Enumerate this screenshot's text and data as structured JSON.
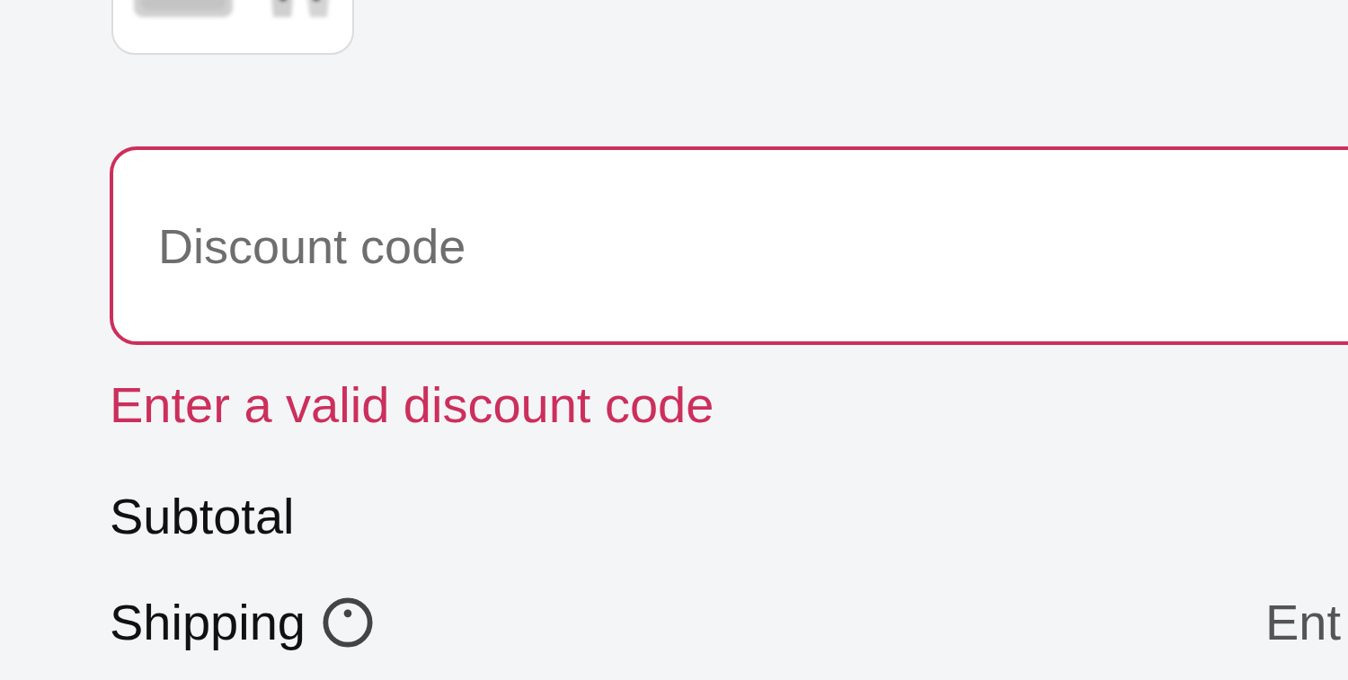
{
  "discount": {
    "placeholder": "Discount code",
    "invalid": true,
    "error": "Enter a valid discount code"
  },
  "summary": [
    {
      "label": "Subtotal",
      "help": false
    },
    {
      "label": "Shipping",
      "help": true,
      "value": "Ent"
    }
  ]
}
